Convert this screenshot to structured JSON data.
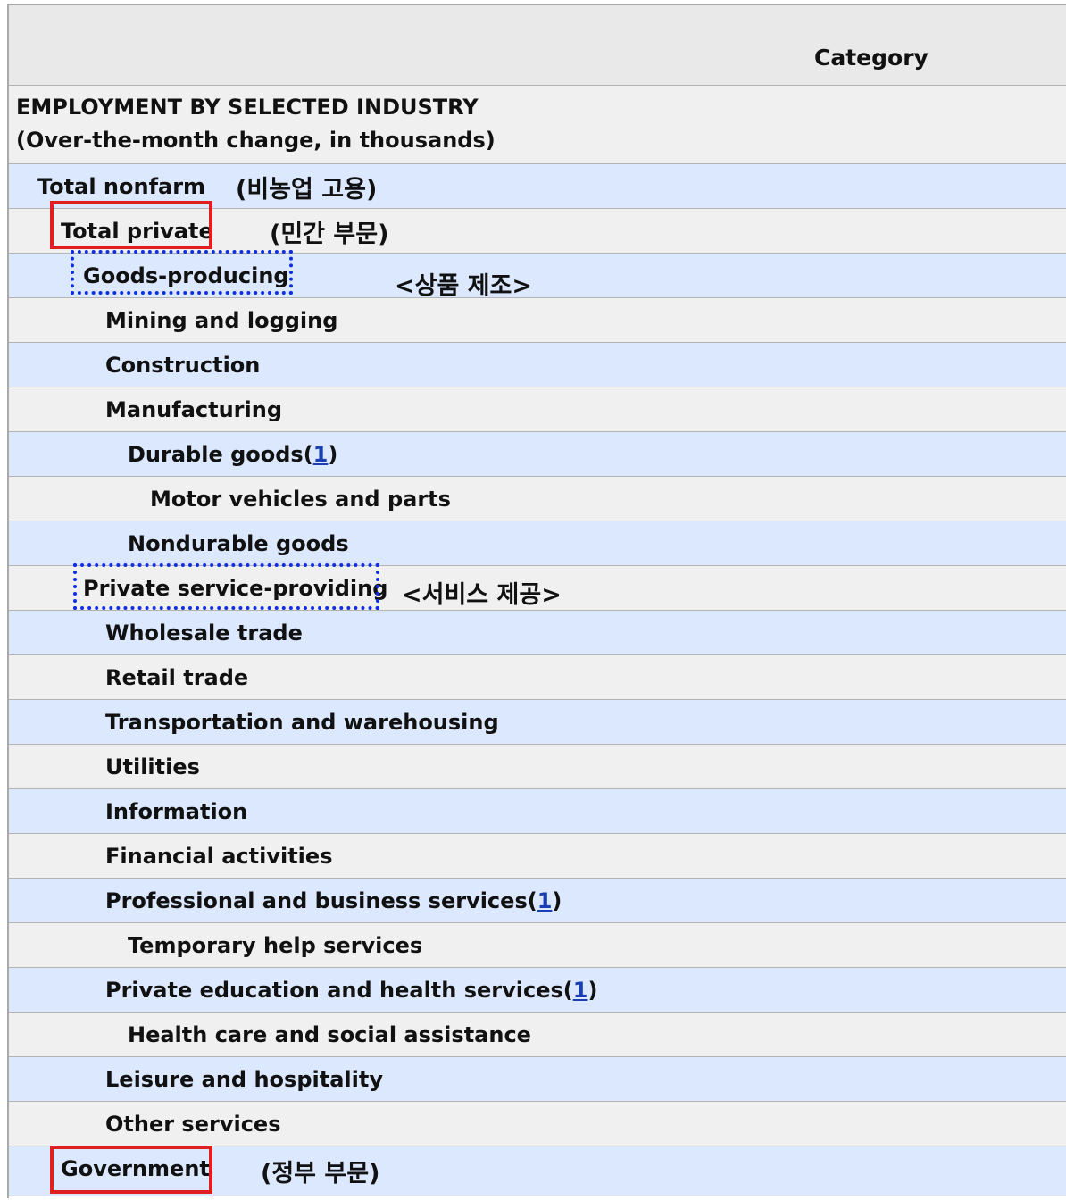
{
  "table": {
    "header": {
      "category": "Category"
    },
    "section": {
      "title": "EMPLOYMENT BY SELECTED INDUSTRY",
      "subtitle": "(Over-the-month change, in thousands)"
    },
    "footnote_mark": "1",
    "rows": [
      {
        "label": "Total nonfarm",
        "note": "(비농업 고용)"
      },
      {
        "label": "Total private",
        "note": "(민간 부문)"
      },
      {
        "label": "Goods-producing",
        "note": "<상품 제조>"
      },
      {
        "label": "Mining and logging"
      },
      {
        "label": "Construction"
      },
      {
        "label": "Manufacturing"
      },
      {
        "label": "Durable goods"
      },
      {
        "label": "Motor vehicles and parts"
      },
      {
        "label": "Nondurable goods"
      },
      {
        "label": "Private service-providing",
        "note": "<서비스 제공>"
      },
      {
        "label": "Wholesale trade"
      },
      {
        "label": "Retail trade"
      },
      {
        "label": "Transportation and warehousing"
      },
      {
        "label": "Utilities"
      },
      {
        "label": "Information"
      },
      {
        "label": "Financial activities"
      },
      {
        "label": "Professional and business services"
      },
      {
        "label": "Temporary help services"
      },
      {
        "label": "Private education and health services"
      },
      {
        "label": "Health care and social assistance"
      },
      {
        "label": "Leisure and hospitality"
      },
      {
        "label": "Other services"
      },
      {
        "label": "Government",
        "note": "(정부 부문)"
      }
    ]
  },
  "colors": {
    "row_blue": "#dbe8fd",
    "row_gray": "#f0f0f0",
    "highlight_red": "#e02020",
    "highlight_blue": "#1030e0",
    "footnote_link": "#1a3fb5"
  }
}
